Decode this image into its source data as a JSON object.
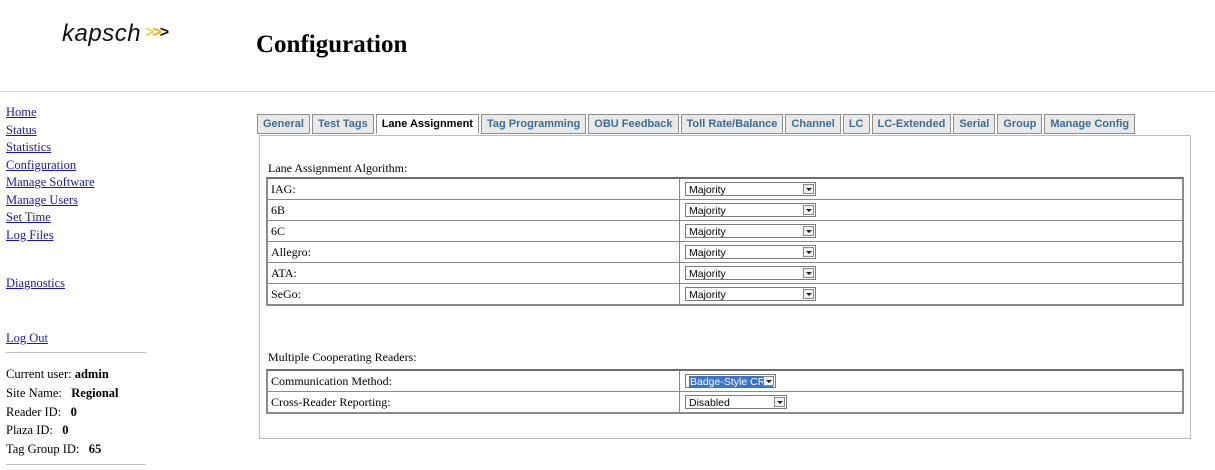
{
  "header": {
    "logo_text": "kapsch",
    "logo_chevrons": ">>>",
    "title": "Configuration"
  },
  "sidebar": {
    "nav": [
      "Home",
      "Status",
      "Statistics",
      "Configuration",
      "Manage Software",
      "Manage Users",
      "Set Time",
      "Log Files"
    ],
    "diagnostics": "Diagnostics",
    "logout": "Log Out",
    "user_info": {
      "current_user_label": "Current user:",
      "current_user": "admin",
      "site_name_label": "Site Name:",
      "site_name": "Regional",
      "reader_id_label": "Reader ID:",
      "reader_id": "0",
      "plaza_id_label": "Plaza ID:",
      "plaza_id": "0",
      "tag_group_id_label": "Tag Group ID:",
      "tag_group_id": "65"
    }
  },
  "tabs": [
    "General",
    "Test Tags",
    "Lane Assignment",
    "Tag Programming",
    "OBU Feedback",
    "Toll Rate/Balance",
    "Channel",
    "LC",
    "LC-Extended",
    "Serial",
    "Group",
    "Manage Config"
  ],
  "active_tab": "Lane Assignment",
  "lane_assignment": {
    "section_title": "Lane Assignment Algorithm:",
    "rows": [
      {
        "label": "IAG:",
        "value": "Majority"
      },
      {
        "label": "6B",
        "value": "Majority"
      },
      {
        "label": "6C",
        "value": "Majority"
      },
      {
        "label": "Allegro:",
        "value": "Majority"
      },
      {
        "label": "ATA:",
        "value": "Majority"
      },
      {
        "label": "SeGo:",
        "value": "Majority"
      }
    ]
  },
  "cooperating": {
    "section_title": "Multiple Cooperating Readers:",
    "rows": [
      {
        "label": "Communication Method:",
        "value": "Badge-Style CRA"
      },
      {
        "label": "Cross-Reader Reporting:",
        "value": "Disabled"
      }
    ]
  },
  "colors": {
    "link": "#1a1aa6",
    "tab_text": "#3a6d98",
    "selection_highlight": "#3d73c6"
  }
}
